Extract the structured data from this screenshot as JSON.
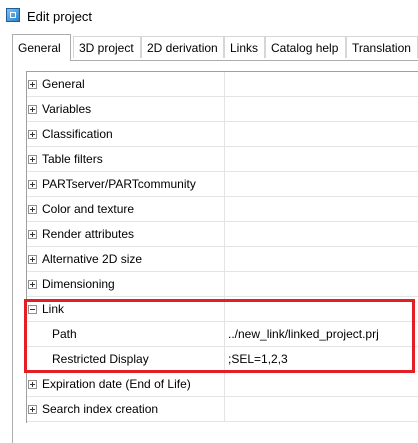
{
  "window": {
    "title": "Edit project",
    "icon": "project-window-icon"
  },
  "tabs": [
    {
      "label": "General",
      "active": true
    },
    {
      "label": "3D project",
      "active": false
    },
    {
      "label": "2D derivation",
      "active": false
    },
    {
      "label": "Links",
      "active": false
    },
    {
      "label": "Catalog help",
      "active": false
    },
    {
      "label": "Translation",
      "active": false
    }
  ],
  "properties": {
    "general": {
      "label": "General",
      "expander": "plus"
    },
    "variables": {
      "label": "Variables",
      "expander": "plus"
    },
    "classification": {
      "label": "Classification",
      "expander": "plus"
    },
    "table_filters": {
      "label": "Table filters",
      "expander": "plus"
    },
    "partserver": {
      "label": "PARTserver/PARTcommunity",
      "expander": "plus"
    },
    "color_texture": {
      "label": "Color and texture",
      "expander": "plus"
    },
    "render_attributes": {
      "label": "Render attributes",
      "expander": "plus"
    },
    "alt_2d_size": {
      "label": "Alternative 2D size",
      "expander": "plus"
    },
    "dimensioning": {
      "label": "Dimensioning",
      "expander": "plus"
    },
    "link": {
      "label": "Link",
      "expander": "minus",
      "path": {
        "label": "Path",
        "value": "../new_link/linked_project.prj"
      },
      "restricted_display": {
        "label": "Restricted Display",
        "value": ";SEL=1,2,3"
      }
    },
    "expiration": {
      "label": "Expiration date (End of Life)",
      "expander": "plus"
    },
    "search_index": {
      "label": "Search index creation",
      "expander": "plus"
    }
  },
  "colors": {
    "highlight_border": "#e31e24",
    "grid_line": "#e4e4e4",
    "tab_border": "#adadad"
  }
}
